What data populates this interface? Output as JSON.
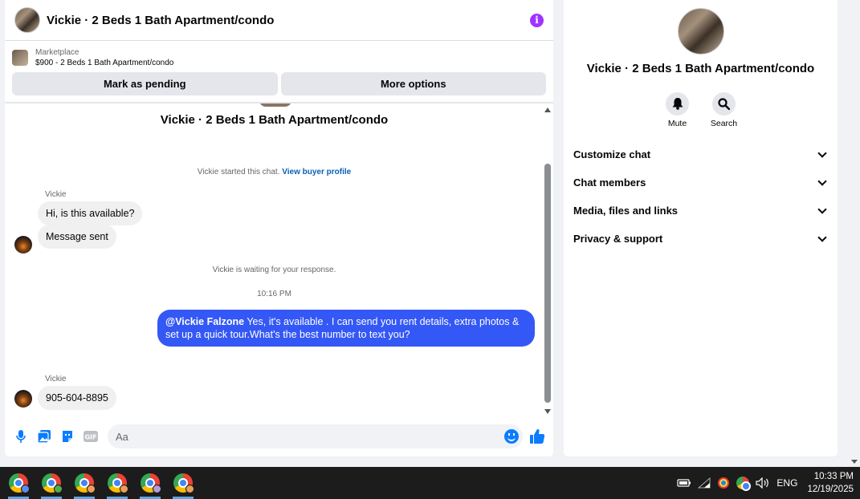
{
  "chat": {
    "header_title": "Vickie · 2 Beds 1 Bath Apartment/condo",
    "marketplace_label": "Marketplace",
    "listing_title": "$900 - 2 Beds 1 Bath Apartment/condo",
    "mark_pending_label": "Mark as pending",
    "more_options_label": "More options",
    "conversation_title": "Vickie · 2 Beds 1 Bath Apartment/condo",
    "started_text": "Vickie started this chat.",
    "view_profile_link": "View buyer profile",
    "waiting_text": "Vickie is waiting for your response.",
    "messages": [
      {
        "sender": "Vickie",
        "text": "Hi, is this available?"
      },
      {
        "text": "Message sent"
      },
      {
        "timestamp": "10:16 PM"
      },
      {
        "mention": "@Vickie Falzone",
        "text": " Yes, it's available .  I can send you rent details, extra photos & set up a quick tour.What's the best number to text you?"
      },
      {
        "sender": "Vickie",
        "text": "905-604-8895"
      }
    ],
    "composer_placeholder": "Aa"
  },
  "details": {
    "title": "Vickie · 2 Beds 1 Bath Apartment/condo",
    "actions": [
      {
        "label": "Mute",
        "icon": "bell-icon"
      },
      {
        "label": "Search",
        "icon": "search-icon"
      }
    ],
    "menu": [
      {
        "label": "Customize chat"
      },
      {
        "label": "Chat members"
      },
      {
        "label": "Media, files and links"
      },
      {
        "label": "Privacy & support"
      }
    ]
  },
  "taskbar": {
    "apps": [
      {
        "icon": "chrome-icon",
        "profile_color": "#5b8def",
        "active": true
      },
      {
        "icon": "chrome-icon",
        "profile_color": "#4caf50",
        "active": true
      },
      {
        "icon": "chrome-icon",
        "profile_color": "#e8a05a",
        "active": true
      },
      {
        "icon": "chrome-icon",
        "profile_color": "#e8a05a",
        "active": true
      },
      {
        "icon": "chrome-icon",
        "profile_color": "#b39ddb",
        "active": true
      },
      {
        "icon": "chrome-icon",
        "profile_color": "#e8a05a",
        "active": true
      }
    ],
    "language": "ENG",
    "time": "10:33 PM",
    "date": "12/19/2025"
  },
  "colors": {
    "accent": "#0a7cff",
    "outgoing_bubble": "#3458f5",
    "info": "#a033ff"
  }
}
